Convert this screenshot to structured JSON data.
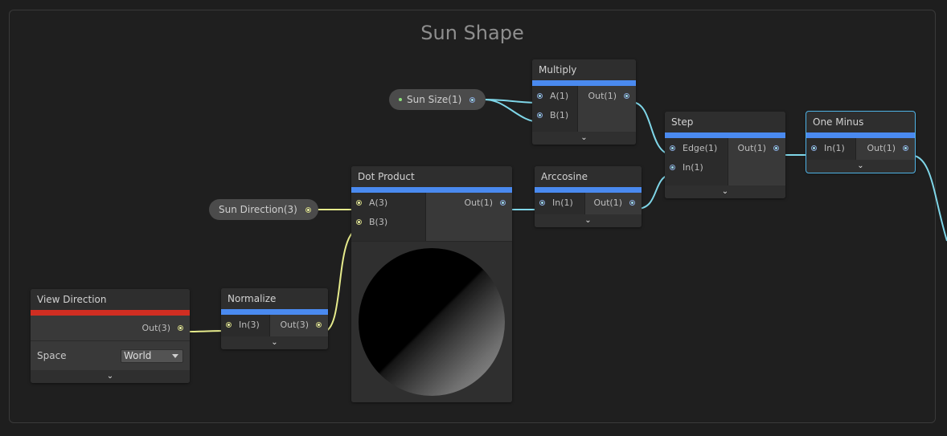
{
  "group_title": "Sun Shape",
  "properties": {
    "sun_size": "Sun Size(1)",
    "sun_direction": "Sun Direction(3)"
  },
  "nodes": {
    "view_direction": {
      "title": "View Direction",
      "out": "Out(3)",
      "space_label": "Space",
      "space_value": "World"
    },
    "normalize": {
      "title": "Normalize",
      "in": "In(3)",
      "out": "Out(3)"
    },
    "dot_product": {
      "title": "Dot Product",
      "a": "A(3)",
      "b": "B(3)",
      "out": "Out(1)"
    },
    "multiply": {
      "title": "Multiply",
      "a": "A(1)",
      "b": "B(1)",
      "out": "Out(1)"
    },
    "arccosine": {
      "title": "Arccosine",
      "in": "In(1)",
      "out": "Out(1)"
    },
    "step": {
      "title": "Step",
      "edge": "Edge(1)",
      "in": "In(1)",
      "out": "Out(1)"
    },
    "one_minus": {
      "title": "One Minus",
      "in": "In(1)",
      "out": "Out(1)"
    }
  },
  "colors": {
    "accent_bar": "#4a8af0",
    "input_bar": "#d02e22",
    "vector3_wire": "#e6eb8c",
    "float_wire": "#7fd6e8",
    "selection": "#4fb3e6"
  },
  "icons": {
    "collapse": "chevron-down-icon"
  }
}
